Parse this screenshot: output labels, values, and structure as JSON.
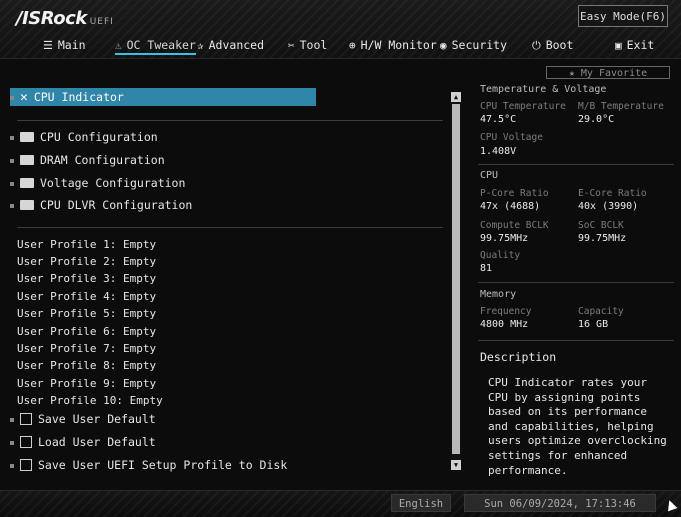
{
  "brand": {
    "logo": "/ISRock",
    "suffix": "UEFI"
  },
  "header": {
    "easy_mode_label": "Easy Mode(F6)"
  },
  "nav": [
    {
      "label": "Main",
      "icon": "list-icon",
      "glyph": "☰"
    },
    {
      "label": "OC Tweaker",
      "icon": "rocket-icon",
      "glyph": "⚠"
    },
    {
      "label": "Advanced",
      "icon": "star-icon",
      "glyph": "✰"
    },
    {
      "label": "Tool",
      "icon": "tool-icon",
      "glyph": "✂"
    },
    {
      "label": "H/W Monitor",
      "icon": "monitor-icon",
      "glyph": "⊕"
    },
    {
      "label": "Security",
      "icon": "shield-icon",
      "glyph": "◉"
    },
    {
      "label": "Boot",
      "icon": "power-icon",
      "glyph": "⏻"
    },
    {
      "label": "Exit",
      "icon": "exit-icon",
      "glyph": "▣"
    }
  ],
  "favorite": {
    "label": "★ My Favorite"
  },
  "menu": {
    "selected": {
      "label": "CPU Indicator",
      "icon": "wrench-icon",
      "glyph": "✕"
    },
    "items": [
      "CPU Configuration",
      "DRAM Configuration",
      "Voltage Configuration",
      "CPU DLVR Configuration"
    ],
    "profiles": [
      "User Profile 1: Empty",
      "User Profile 2: Empty",
      "User Profile 3: Empty",
      "User Profile 4: Empty",
      "User Profile 5: Empty",
      "User Profile 6: Empty",
      "User Profile 7: Empty",
      "User Profile 8: Empty",
      "User Profile 9: Empty",
      "User Profile 10: Empty"
    ],
    "actions": [
      {
        "label": "Save User Default",
        "icon": "save-icon"
      },
      {
        "label": "Load User Default",
        "icon": "load-icon"
      },
      {
        "label": "Save User UEFI Setup Profile to Disk",
        "icon": "disk-icon"
      }
    ]
  },
  "panel": {
    "temp_voltage_title": "Temperature & Voltage",
    "cpu_temp_label": "CPU Temperature",
    "cpu_temp": "47.5°C",
    "mb_temp_label": "M/B Temperature",
    "mb_temp": "29.0°C",
    "cpu_voltage_label": "CPU Voltage",
    "cpu_voltage": "1.408V",
    "cpu_title": "CPU",
    "pcore_label": "P-Core Ratio",
    "pcore": "47x (4688)",
    "ecore_label": "E-Core Ratio",
    "ecore": "40x (3990)",
    "bclk_label": "Compute BCLK",
    "bclk": "99.75MHz",
    "soc_label": "SoC BCLK",
    "soc": "99.75MHz",
    "quality_label": "Quality",
    "quality": "81",
    "memory_title": "Memory",
    "freq_label": "Frequency",
    "freq": "4800 MHz",
    "cap_label": "Capacity",
    "cap": "16 GB",
    "desc_title": "Description",
    "desc_text": "CPU Indicator rates your CPU by assigning points based on its performance and capabilities, helping users optimize overclocking settings for enhanced performance."
  },
  "footer": {
    "language": "English",
    "datetime": "Sun 06/09/2024, 17:13:46"
  },
  "colors": {
    "accent": "#2f86a8",
    "underline": "#3ac0e0"
  }
}
